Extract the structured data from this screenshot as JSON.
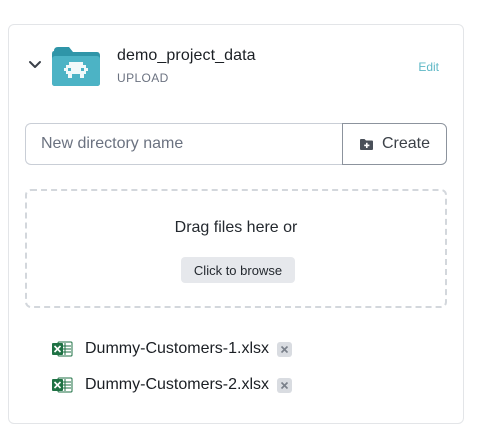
{
  "project": {
    "name": "demo_project_data",
    "type_label": "UPLOAD",
    "edit_label": "Edit",
    "icon": "folder-icon"
  },
  "new_directory": {
    "placeholder": "New directory name",
    "value": "",
    "create_label": "Create"
  },
  "dropzone": {
    "text": "Drag files here or",
    "browse_label": "Click to browse"
  },
  "files": [
    {
      "name": "Dummy-Customers-1.xlsx",
      "icon": "excel-file-icon"
    },
    {
      "name": "Dummy-Customers-2.xlsx",
      "icon": "excel-file-icon"
    }
  ],
  "colors": {
    "accent": "#5fb8c6",
    "folder": "#3aa6b9",
    "excel": "#1f7244"
  }
}
